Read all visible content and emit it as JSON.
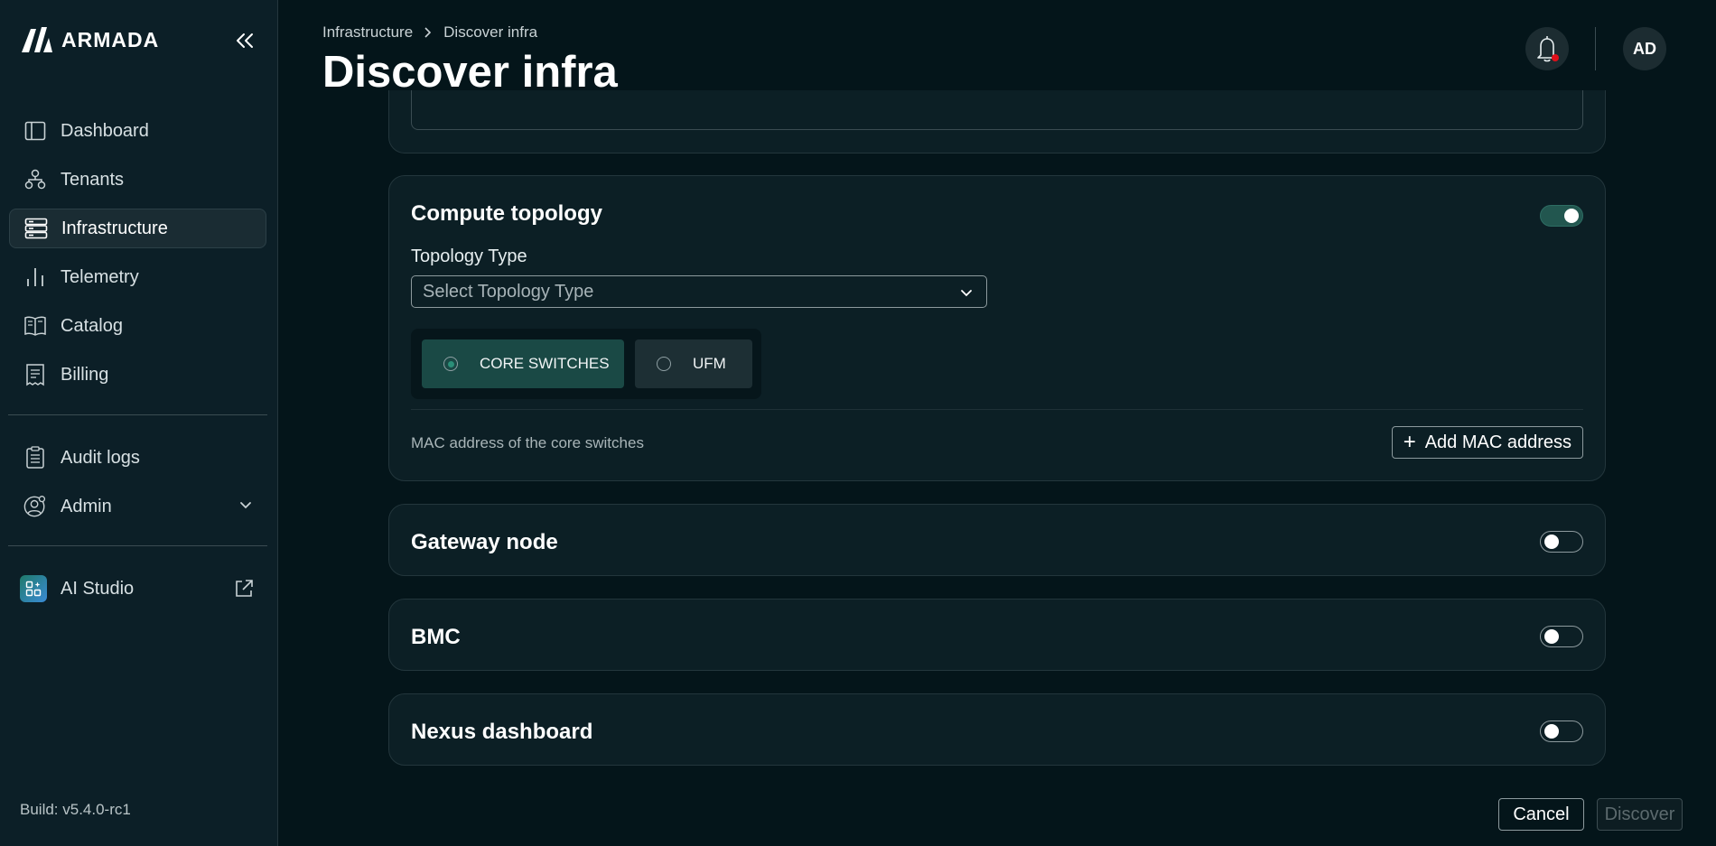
{
  "brand": {
    "name": "ARMADA"
  },
  "sidebar": {
    "items": [
      {
        "label": "Dashboard",
        "icon": "dashboard-icon"
      },
      {
        "label": "Tenants",
        "icon": "tenants-icon"
      },
      {
        "label": "Infrastructure",
        "icon": "server-icon",
        "active": true
      },
      {
        "label": "Telemetry",
        "icon": "bar-chart-icon"
      },
      {
        "label": "Catalog",
        "icon": "book-icon"
      },
      {
        "label": "Billing",
        "icon": "receipt-icon"
      }
    ],
    "secondary": [
      {
        "label": "Audit logs",
        "icon": "clipboard-icon"
      },
      {
        "label": "Admin",
        "icon": "user-gear-icon",
        "expandable": true
      }
    ],
    "ai_studio": {
      "label": "AI Studio",
      "icon": "ai-studio-icon",
      "external": true
    },
    "build": "Build: v5.4.0-rc1"
  },
  "header": {
    "breadcrumb": [
      "Infrastructure",
      "Discover infra"
    ],
    "title": "Discover infra",
    "avatar_initials": "AD",
    "notification_dot_color": "#e0101a"
  },
  "sections": {
    "compute": {
      "title": "Compute topology",
      "enabled": true,
      "topology_type_label": "Topology Type",
      "topology_type_placeholder": "Select Topology Type",
      "segment_options": [
        "CORE SWITCHES",
        "UFM"
      ],
      "segment_selected": "CORE SWITCHES",
      "mac_label": "MAC address of the core switches",
      "add_mac_label": "Add MAC address"
    },
    "gateway": {
      "title": "Gateway node",
      "enabled": false
    },
    "bmc": {
      "title": "BMC",
      "enabled": false
    },
    "nexus": {
      "title": "Nexus dashboard",
      "enabled": false
    }
  },
  "actions": {
    "cancel": "Cancel",
    "discover": "Discover",
    "discover_disabled": true
  },
  "colors": {
    "background": "#04151a",
    "sidebar": "#0c1f27",
    "accent": "#1a4945",
    "toggle_on": "#22564f"
  }
}
